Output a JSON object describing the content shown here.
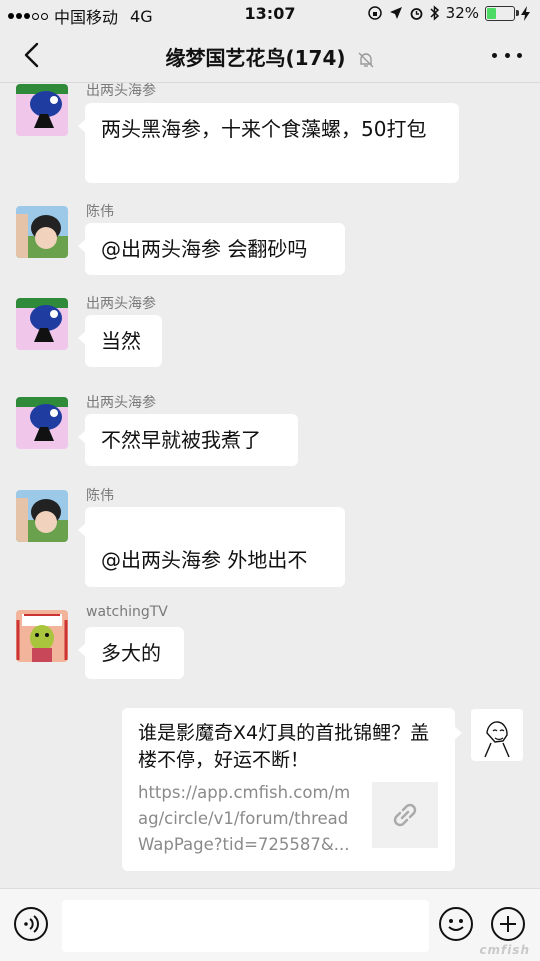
{
  "status_bar": {
    "carrier": "中国移动",
    "network": "4G",
    "time": "13:07",
    "battery_percent": "32%",
    "battery_level": 0.32
  },
  "nav": {
    "title": "缘梦国艺花鸟(174)",
    "back_icon": "chevron-left-icon",
    "mute_icon": "bell-off-icon",
    "more_icon": "more-dots-icon"
  },
  "messages": [
    {
      "sender": "出两头海参",
      "text": "两头黑海参，十来个食藻螺，50打包",
      "side": "left"
    },
    {
      "sender": "陈伟",
      "text": "@出两头海参 会翻砂吗",
      "side": "left"
    },
    {
      "sender": "出两头海参",
      "text": "当然",
      "side": "left"
    },
    {
      "sender": "出两头海参",
      "text": "不然早就被我煮了",
      "side": "left"
    },
    {
      "sender": "陈伟",
      "text": "@出两头海参 外地出不",
      "side": "left"
    },
    {
      "sender": "watchingTV",
      "text": "多大的",
      "side": "left"
    }
  ],
  "link_card": {
    "title": "谁是影魔奇X4灯具的首批锦鲤？盖楼不停，好运不断！",
    "url": "https://app.cmfish.com/mag/circle/v1/forum/threadWapPage?tid=725587&...",
    "thumb_icon": "link-icon"
  },
  "input_bar": {
    "voice_icon": "voice-icon",
    "emoji_icon": "emoji-icon",
    "plus_icon": "plus-circle-icon"
  },
  "watermark": "cmfish"
}
